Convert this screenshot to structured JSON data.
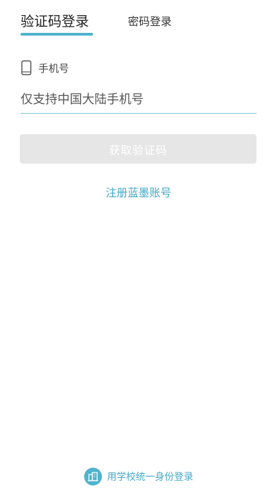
{
  "tabs": {
    "sms_login": "验证码登录",
    "password_login": "密码登录"
  },
  "phone": {
    "label": "手机号",
    "placeholder": "仅支持中国大陆手机号",
    "value": ""
  },
  "actions": {
    "get_code": "获取验证码",
    "register": "注册蓝墨账号",
    "school_sso": "用学校统一身份登录"
  },
  "colors": {
    "accent": "#4fb3cc",
    "link": "#44a9c6",
    "disabled_button": "#e6e6e6"
  },
  "icons": {
    "phone": "phone-icon",
    "school": "school-building-icon"
  }
}
